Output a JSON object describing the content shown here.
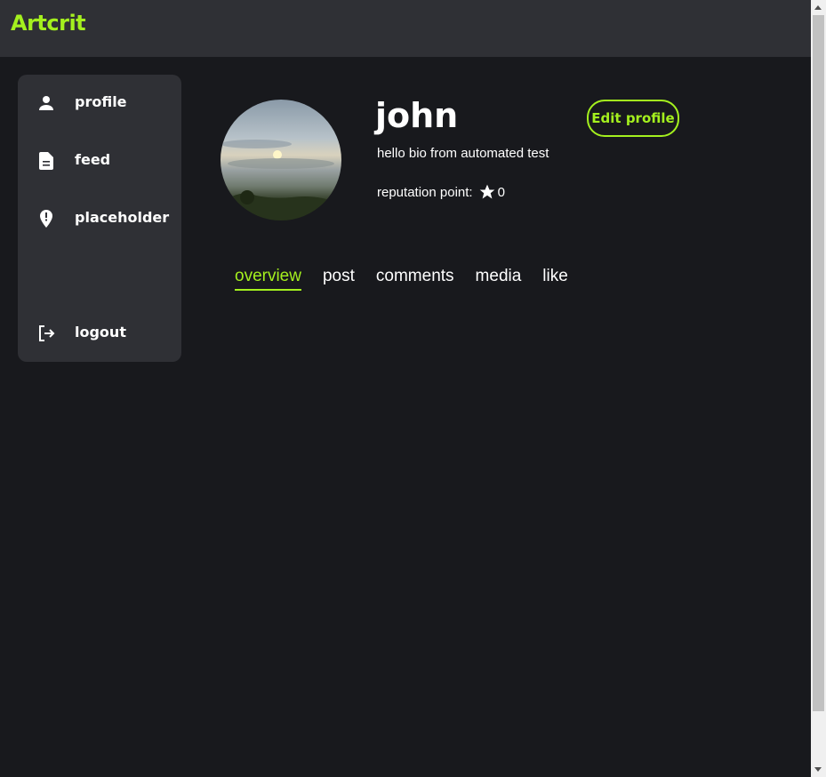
{
  "app": {
    "brand": "Artcrit",
    "brand_color": "#a4f01e"
  },
  "sidebar": {
    "items": [
      {
        "label": "profile",
        "icon": "person-icon"
      },
      {
        "label": "feed",
        "icon": "document-icon"
      },
      {
        "label": "placeholder",
        "icon": "location-alert-icon"
      },
      {
        "label": "logout",
        "icon": "logout-icon"
      }
    ]
  },
  "profile": {
    "username": "john",
    "edit_label": "Edit profile",
    "bio": "hello bio from automated test",
    "reputation_label": "reputation point:",
    "reputation_value": "0"
  },
  "tabs": [
    {
      "label": "overview",
      "active": true
    },
    {
      "label": "post",
      "active": false
    },
    {
      "label": "comments",
      "active": false
    },
    {
      "label": "media",
      "active": false
    },
    {
      "label": "like",
      "active": false
    }
  ]
}
